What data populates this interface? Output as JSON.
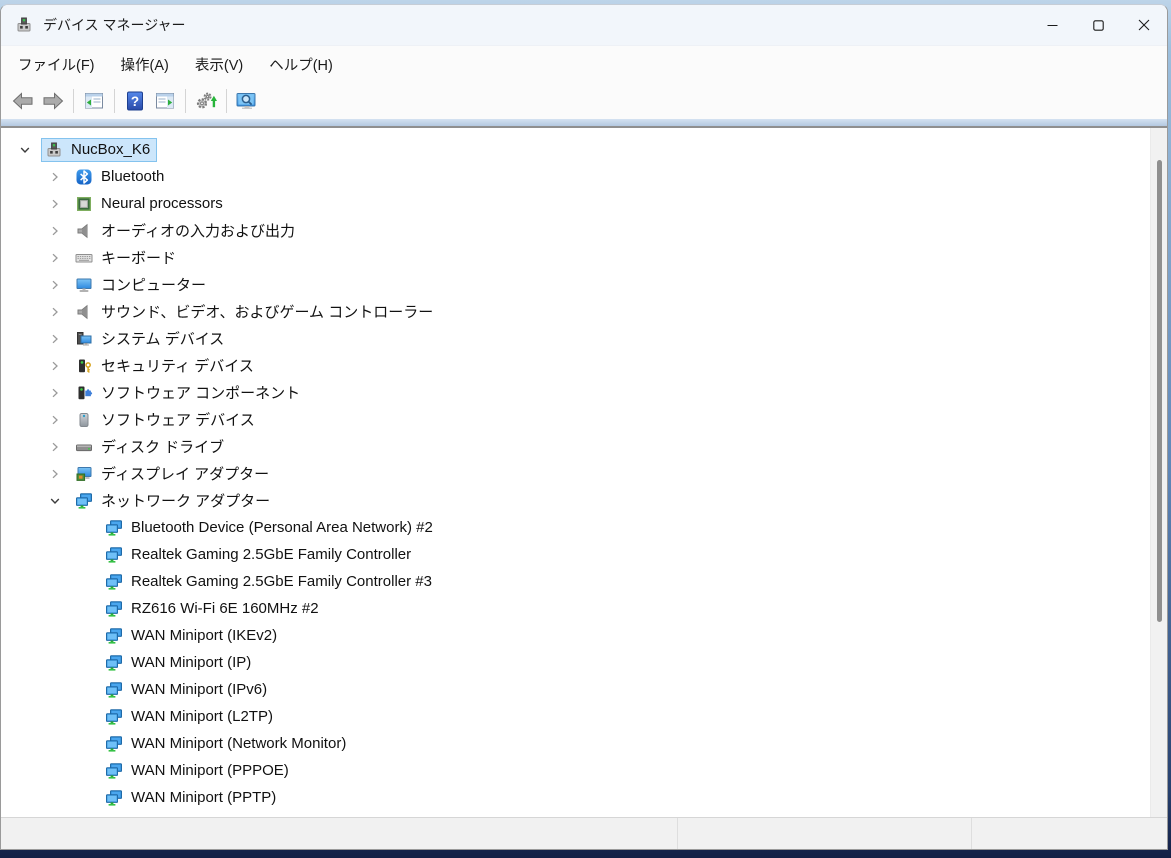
{
  "window": {
    "title": "デバイス マネージャー",
    "app_icon": "device-manager-icon",
    "controls": [
      {
        "id": "minimize",
        "icon": "minimize-icon"
      },
      {
        "id": "maximize",
        "icon": "maximize-icon"
      },
      {
        "id": "close",
        "icon": "close-icon"
      }
    ]
  },
  "menu": {
    "items": [
      {
        "id": "file",
        "label": "ファイル(F)"
      },
      {
        "id": "action",
        "label": "操作(A)"
      },
      {
        "id": "view",
        "label": "表示(V)"
      },
      {
        "id": "help",
        "label": "ヘルプ(H)"
      }
    ]
  },
  "toolbar": {
    "buttons": [
      {
        "id": "back",
        "icon": "back-arrow-icon"
      },
      {
        "id": "forward",
        "icon": "forward-arrow-icon"
      },
      {
        "sep": true
      },
      {
        "id": "show-hide-console-tree",
        "icon": "console-tree-icon"
      },
      {
        "sep": true
      },
      {
        "id": "help",
        "icon": "help-icon"
      },
      {
        "id": "show-hide-action-pane",
        "icon": "action-pane-icon"
      },
      {
        "sep": true
      },
      {
        "id": "update-driver",
        "icon": "gears-update-icon"
      },
      {
        "sep": true
      },
      {
        "id": "scan-hardware-changes",
        "icon": "monitor-search-icon"
      }
    ]
  },
  "tree": {
    "rows": [
      {
        "label": "NucBox_K6",
        "level": 0,
        "state": "expanded",
        "icon": "device-manager-icon",
        "selected": true
      },
      {
        "label": "Bluetooth",
        "level": 1,
        "state": "collapsed",
        "icon": "bluetooth-icon",
        "selected": false
      },
      {
        "label": "Neural processors",
        "level": 1,
        "state": "collapsed",
        "icon": "chip-icon",
        "selected": false
      },
      {
        "label": "オーディオの入力および出力",
        "level": 1,
        "state": "collapsed",
        "icon": "speaker-icon",
        "selected": false
      },
      {
        "label": "キーボード",
        "level": 1,
        "state": "collapsed",
        "icon": "keyboard-icon",
        "selected": false
      },
      {
        "label": "コンピューター",
        "level": 1,
        "state": "collapsed",
        "icon": "monitor-icon",
        "selected": false
      },
      {
        "label": "サウンド、ビデオ、およびゲーム コントローラー",
        "level": 1,
        "state": "collapsed",
        "icon": "speaker-icon",
        "selected": false
      },
      {
        "label": "システム デバイス",
        "level": 1,
        "state": "collapsed",
        "icon": "system-devices-icon",
        "selected": false
      },
      {
        "label": "セキュリティ デバイス",
        "level": 1,
        "state": "collapsed",
        "icon": "security-device-icon",
        "selected": false
      },
      {
        "label": "ソフトウェア コンポーネント",
        "level": 1,
        "state": "collapsed",
        "icon": "software-component-icon",
        "selected": false
      },
      {
        "label": "ソフトウェア デバイス",
        "level": 1,
        "state": "collapsed",
        "icon": "software-device-icon",
        "selected": false
      },
      {
        "label": "ディスク ドライブ",
        "level": 1,
        "state": "collapsed",
        "icon": "disk-drive-icon",
        "selected": false
      },
      {
        "label": "ディスプレイ アダプター",
        "level": 1,
        "state": "collapsed",
        "icon": "display-adapter-icon",
        "selected": false
      },
      {
        "label": "ネットワーク アダプター",
        "level": 1,
        "state": "expanded",
        "icon": "network-adapter-icon",
        "selected": false
      },
      {
        "label": "Bluetooth Device (Personal Area Network) #2",
        "level": 2,
        "state": "leaf",
        "icon": "network-adapter-icon",
        "selected": false
      },
      {
        "label": "Realtek Gaming 2.5GbE Family Controller",
        "level": 2,
        "state": "leaf",
        "icon": "network-adapter-icon",
        "selected": false
      },
      {
        "label": "Realtek Gaming 2.5GbE Family Controller #3",
        "level": 2,
        "state": "leaf",
        "icon": "network-adapter-icon",
        "selected": false
      },
      {
        "label": "RZ616 Wi-Fi 6E 160MHz #2",
        "level": 2,
        "state": "leaf",
        "icon": "network-adapter-icon",
        "selected": false
      },
      {
        "label": "WAN Miniport (IKEv2)",
        "level": 2,
        "state": "leaf",
        "icon": "network-adapter-icon",
        "selected": false
      },
      {
        "label": "WAN Miniport (IP)",
        "level": 2,
        "state": "leaf",
        "icon": "network-adapter-icon",
        "selected": false
      },
      {
        "label": "WAN Miniport (IPv6)",
        "level": 2,
        "state": "leaf",
        "icon": "network-adapter-icon",
        "selected": false
      },
      {
        "label": "WAN Miniport (L2TP)",
        "level": 2,
        "state": "leaf",
        "icon": "network-adapter-icon",
        "selected": false
      },
      {
        "label": "WAN Miniport (Network Monitor)",
        "level": 2,
        "state": "leaf",
        "icon": "network-adapter-icon",
        "selected": false
      },
      {
        "label": "WAN Miniport (PPPOE)",
        "level": 2,
        "state": "leaf",
        "icon": "network-adapter-icon",
        "selected": false
      },
      {
        "label": "WAN Miniport (PPTP)",
        "level": 2,
        "state": "leaf",
        "icon": "network-adapter-icon",
        "selected": false
      }
    ]
  },
  "statusbar": {
    "sections": [
      "",
      "",
      ""
    ]
  },
  "colors": {
    "selection_bg": "#cce6fb",
    "selection_border": "#84c3ee",
    "help_blue": "#2a4aa8",
    "green_accent": "#27b43a",
    "network_blue": "#3f9be0"
  }
}
